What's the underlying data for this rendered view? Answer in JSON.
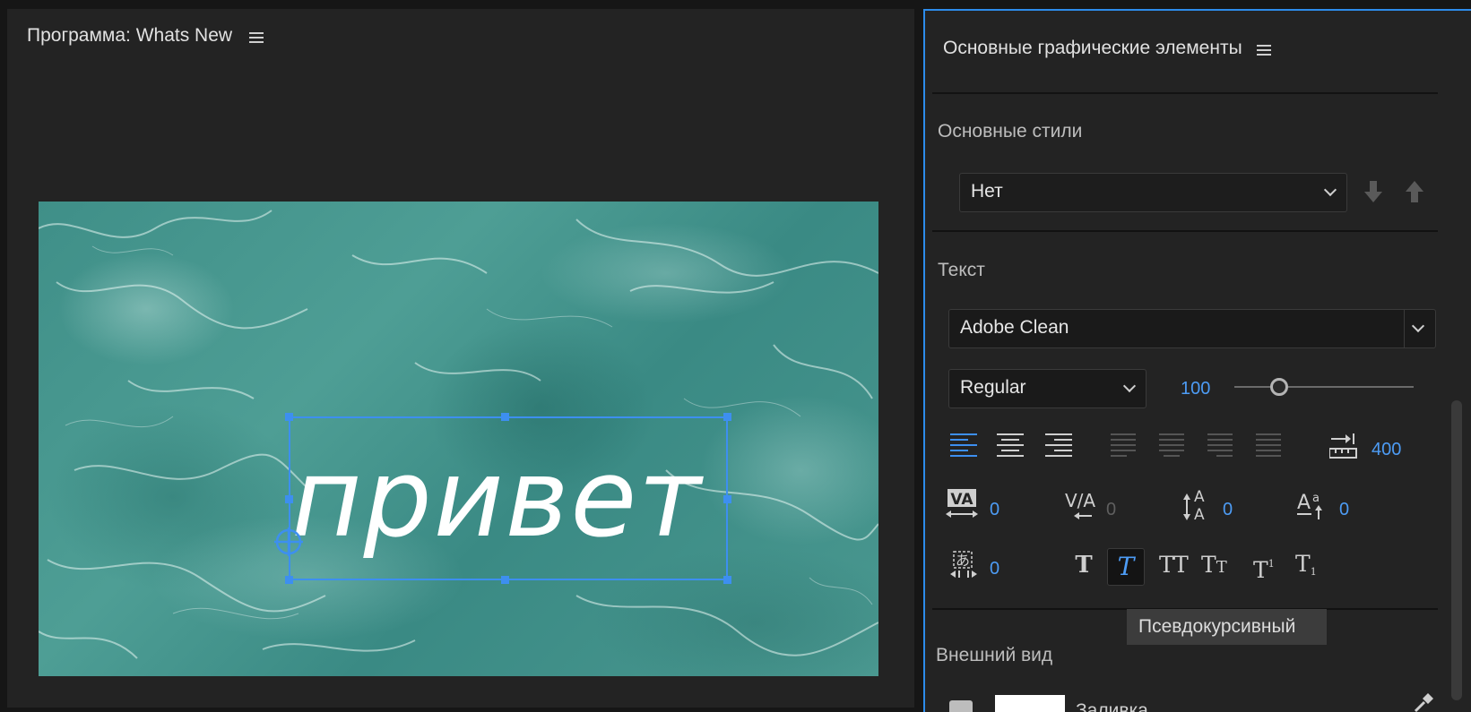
{
  "program": {
    "title": "Программа: Whats New",
    "menu_icon": "hamburger-icon",
    "text_layer": "привет"
  },
  "essential_graphics": {
    "title": "Основные графические элементы",
    "master_styles": {
      "heading": "Основные стили",
      "selected": "Нет"
    },
    "text": {
      "heading": "Текст",
      "font": "Adobe Clean",
      "font_style": "Regular",
      "font_size": "100",
      "font_size_slider_fraction": 0.25,
      "tab_width": "400",
      "tracking": "0",
      "kerning": "0",
      "leading": "0",
      "baseline_shift": "0",
      "tsume": "0"
    },
    "tooltip": "Псевдокурсивный",
    "appearance": {
      "heading": "Внешний вид",
      "fill_label": "Заливка",
      "fill_color": "#ffffff",
      "fill_checked": true
    }
  },
  "colors": {
    "accent": "#3d8ff0",
    "panel_bg": "#232323"
  }
}
